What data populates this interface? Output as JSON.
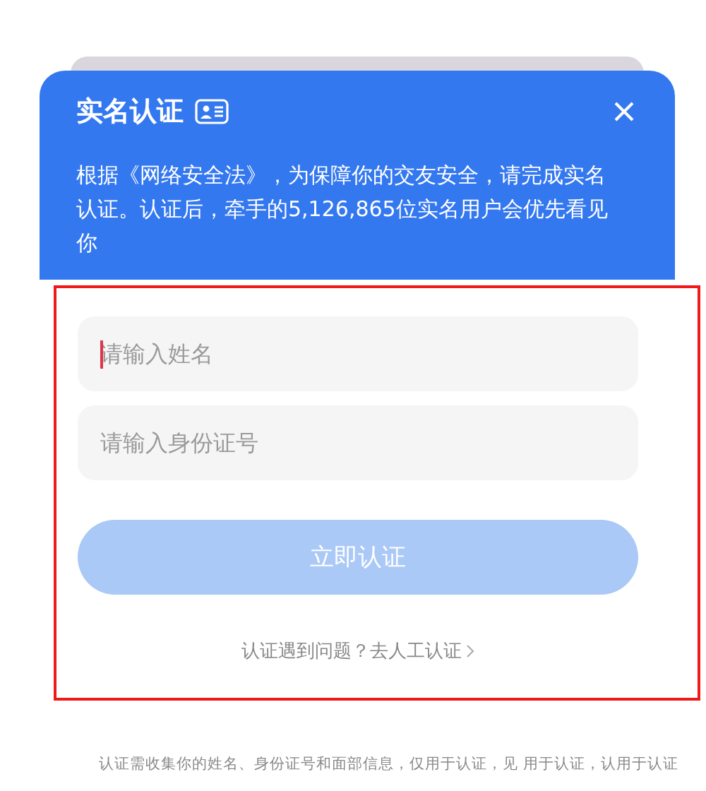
{
  "dialog": {
    "title": "实名认证",
    "description": "根据《网络安全法》，为保障你的交友安全，请完成实名认证。认证后，牵手的5,126,865位实名用户会优先看见你"
  },
  "fields": [
    {
      "placeholder": "请输入姓名",
      "focused": true
    },
    {
      "placeholder": "请输入身份证号",
      "focused": false
    }
  ],
  "submit_button": {
    "label": "立即认证",
    "disabled": true
  },
  "help_link": {
    "label": "认证遇到问题？去人工认证"
  },
  "footer_note": "认证需收集你的姓名、身份证号和面部信息，仅用于认证，见 用于认证，认用于认证"
}
